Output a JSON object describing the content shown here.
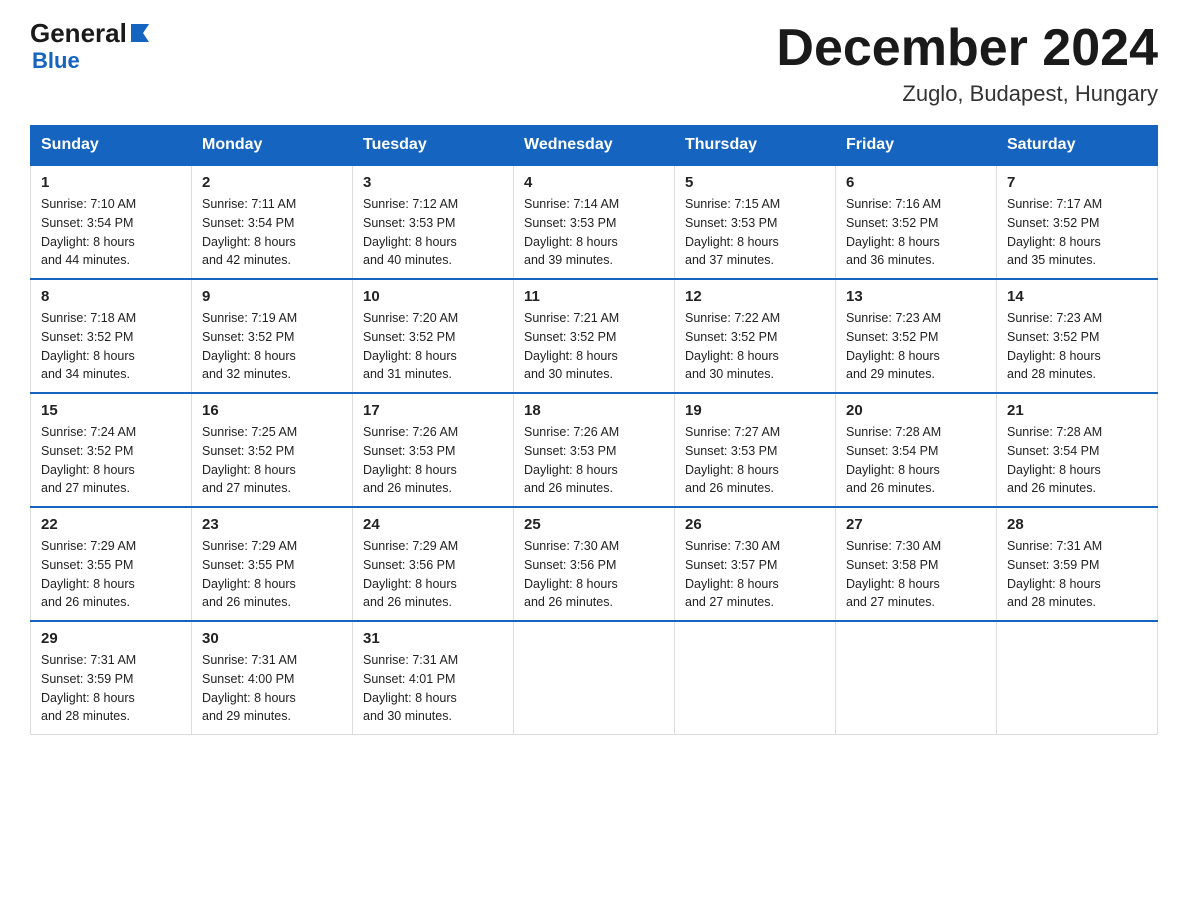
{
  "logo": {
    "general": "General",
    "blue": "Blue"
  },
  "header": {
    "month_year": "December 2024",
    "location": "Zuglo, Budapest, Hungary"
  },
  "days_of_week": [
    "Sunday",
    "Monday",
    "Tuesday",
    "Wednesday",
    "Thursday",
    "Friday",
    "Saturday"
  ],
  "weeks": [
    [
      {
        "day": "1",
        "sunrise": "7:10 AM",
        "sunset": "3:54 PM",
        "daylight": "8 hours and 44 minutes."
      },
      {
        "day": "2",
        "sunrise": "7:11 AM",
        "sunset": "3:54 PM",
        "daylight": "8 hours and 42 minutes."
      },
      {
        "day": "3",
        "sunrise": "7:12 AM",
        "sunset": "3:53 PM",
        "daylight": "8 hours and 40 minutes."
      },
      {
        "day": "4",
        "sunrise": "7:14 AM",
        "sunset": "3:53 PM",
        "daylight": "8 hours and 39 minutes."
      },
      {
        "day": "5",
        "sunrise": "7:15 AM",
        "sunset": "3:53 PM",
        "daylight": "8 hours and 37 minutes."
      },
      {
        "day": "6",
        "sunrise": "7:16 AM",
        "sunset": "3:52 PM",
        "daylight": "8 hours and 36 minutes."
      },
      {
        "day": "7",
        "sunrise": "7:17 AM",
        "sunset": "3:52 PM",
        "daylight": "8 hours and 35 minutes."
      }
    ],
    [
      {
        "day": "8",
        "sunrise": "7:18 AM",
        "sunset": "3:52 PM",
        "daylight": "8 hours and 34 minutes."
      },
      {
        "day": "9",
        "sunrise": "7:19 AM",
        "sunset": "3:52 PM",
        "daylight": "8 hours and 32 minutes."
      },
      {
        "day": "10",
        "sunrise": "7:20 AM",
        "sunset": "3:52 PM",
        "daylight": "8 hours and 31 minutes."
      },
      {
        "day": "11",
        "sunrise": "7:21 AM",
        "sunset": "3:52 PM",
        "daylight": "8 hours and 30 minutes."
      },
      {
        "day": "12",
        "sunrise": "7:22 AM",
        "sunset": "3:52 PM",
        "daylight": "8 hours and 30 minutes."
      },
      {
        "day": "13",
        "sunrise": "7:23 AM",
        "sunset": "3:52 PM",
        "daylight": "8 hours and 29 minutes."
      },
      {
        "day": "14",
        "sunrise": "7:23 AM",
        "sunset": "3:52 PM",
        "daylight": "8 hours and 28 minutes."
      }
    ],
    [
      {
        "day": "15",
        "sunrise": "7:24 AM",
        "sunset": "3:52 PM",
        "daylight": "8 hours and 27 minutes."
      },
      {
        "day": "16",
        "sunrise": "7:25 AM",
        "sunset": "3:52 PM",
        "daylight": "8 hours and 27 minutes."
      },
      {
        "day": "17",
        "sunrise": "7:26 AM",
        "sunset": "3:53 PM",
        "daylight": "8 hours and 26 minutes."
      },
      {
        "day": "18",
        "sunrise": "7:26 AM",
        "sunset": "3:53 PM",
        "daylight": "8 hours and 26 minutes."
      },
      {
        "day": "19",
        "sunrise": "7:27 AM",
        "sunset": "3:53 PM",
        "daylight": "8 hours and 26 minutes."
      },
      {
        "day": "20",
        "sunrise": "7:28 AM",
        "sunset": "3:54 PM",
        "daylight": "8 hours and 26 minutes."
      },
      {
        "day": "21",
        "sunrise": "7:28 AM",
        "sunset": "3:54 PM",
        "daylight": "8 hours and 26 minutes."
      }
    ],
    [
      {
        "day": "22",
        "sunrise": "7:29 AM",
        "sunset": "3:55 PM",
        "daylight": "8 hours and 26 minutes."
      },
      {
        "day": "23",
        "sunrise": "7:29 AM",
        "sunset": "3:55 PM",
        "daylight": "8 hours and 26 minutes."
      },
      {
        "day": "24",
        "sunrise": "7:29 AM",
        "sunset": "3:56 PM",
        "daylight": "8 hours and 26 minutes."
      },
      {
        "day": "25",
        "sunrise": "7:30 AM",
        "sunset": "3:56 PM",
        "daylight": "8 hours and 26 minutes."
      },
      {
        "day": "26",
        "sunrise": "7:30 AM",
        "sunset": "3:57 PM",
        "daylight": "8 hours and 27 minutes."
      },
      {
        "day": "27",
        "sunrise": "7:30 AM",
        "sunset": "3:58 PM",
        "daylight": "8 hours and 27 minutes."
      },
      {
        "day": "28",
        "sunrise": "7:31 AM",
        "sunset": "3:59 PM",
        "daylight": "8 hours and 28 minutes."
      }
    ],
    [
      {
        "day": "29",
        "sunrise": "7:31 AM",
        "sunset": "3:59 PM",
        "daylight": "8 hours and 28 minutes."
      },
      {
        "day": "30",
        "sunrise": "7:31 AM",
        "sunset": "4:00 PM",
        "daylight": "8 hours and 29 minutes."
      },
      {
        "day": "31",
        "sunrise": "7:31 AM",
        "sunset": "4:01 PM",
        "daylight": "8 hours and 30 minutes."
      },
      null,
      null,
      null,
      null
    ]
  ],
  "labels": {
    "sunrise_prefix": "Sunrise: ",
    "sunset_prefix": "Sunset: ",
    "daylight_prefix": "Daylight: "
  }
}
